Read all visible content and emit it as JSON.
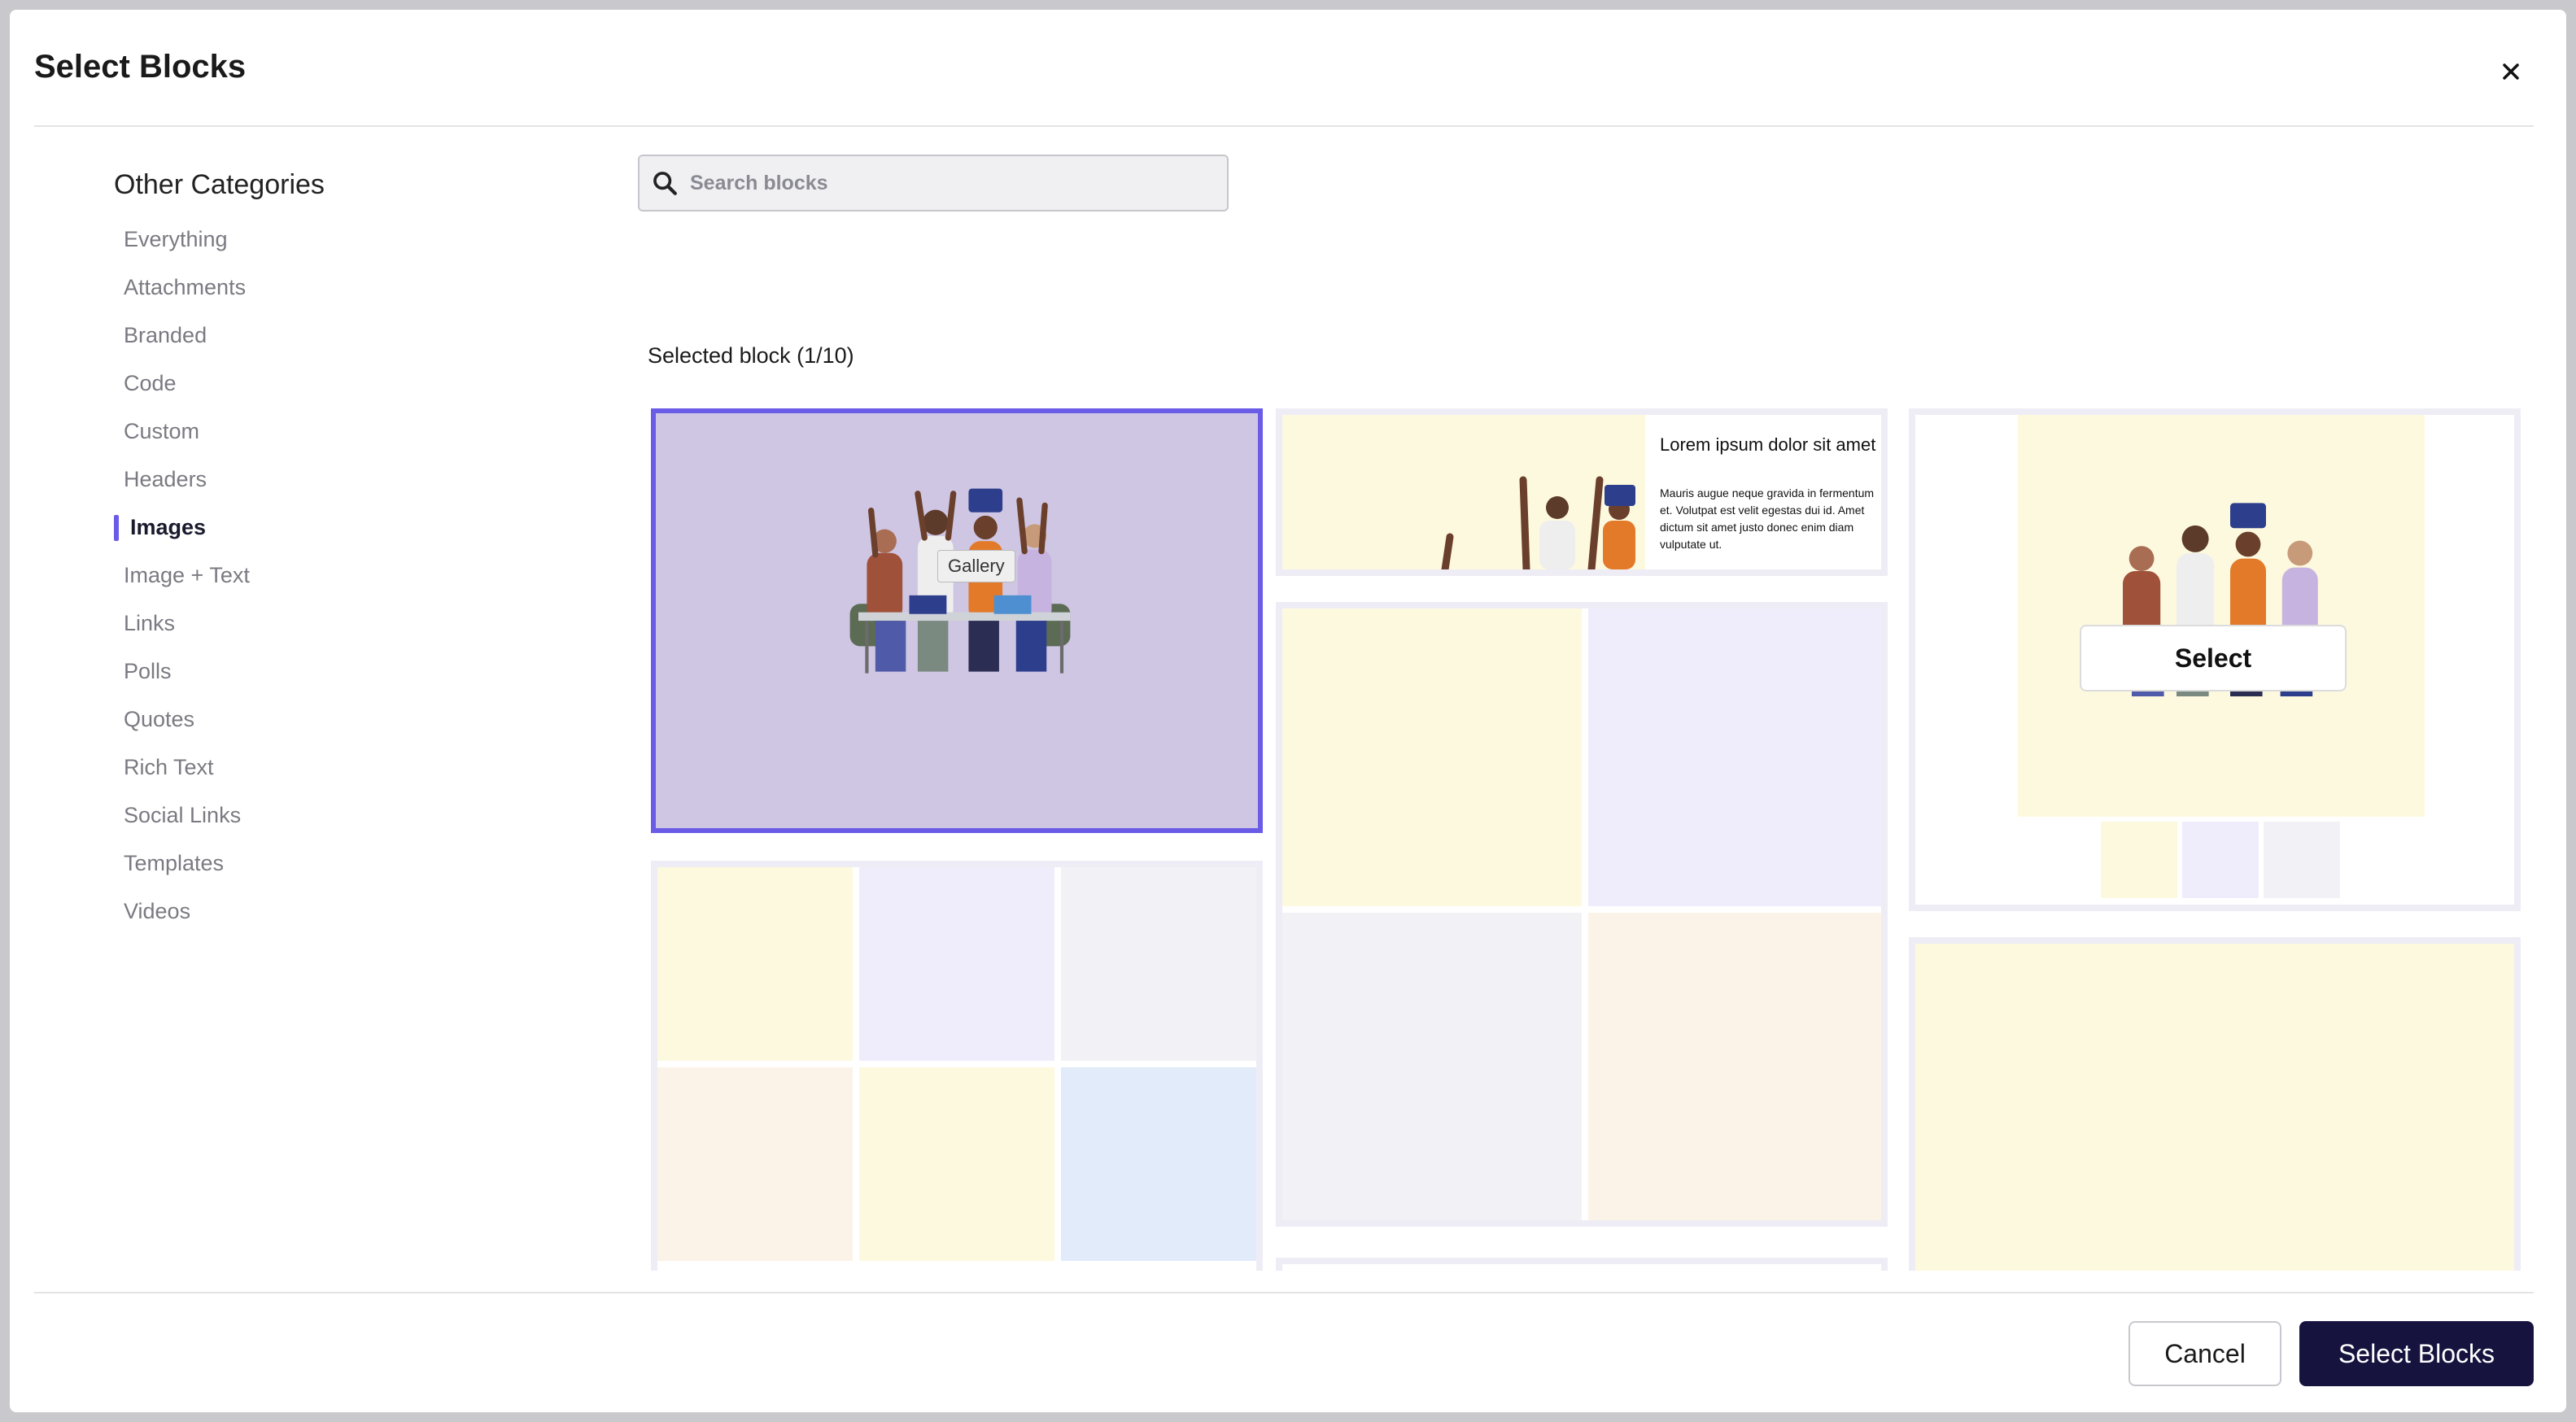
{
  "modal": {
    "title": "Select Blocks",
    "close_icon": "close-icon"
  },
  "sidebar": {
    "heading": "Other Categories",
    "items": [
      "Everything",
      "Attachments",
      "Branded",
      "Code",
      "Custom",
      "Headers",
      "Images",
      "Image + Text",
      "Links",
      "Polls",
      "Quotes",
      "Rich Text",
      "Social Links",
      "Templates",
      "Videos"
    ],
    "active": "Images"
  },
  "search": {
    "placeholder": "Search blocks",
    "icon": "search-icon"
  },
  "selection": {
    "label": "Selected block (1/10)"
  },
  "blocks": {
    "tooltip": "Gallery",
    "text_card": {
      "title": "Lorem ipsum dolor sit amet",
      "body": "Mauris augue neque gravida in fermentum et. Volutpat est velit egestas dui id. Amet dictum sit amet justo donec enim diam vulputate ut."
    },
    "hover_select": "Select"
  },
  "footer": {
    "cancel": "Cancel",
    "confirm": "Select Blocks"
  },
  "colors": {
    "accent": "#6b5ce7",
    "primary_button": "#16143f",
    "selected_card_bg": "#cfc6e3"
  }
}
